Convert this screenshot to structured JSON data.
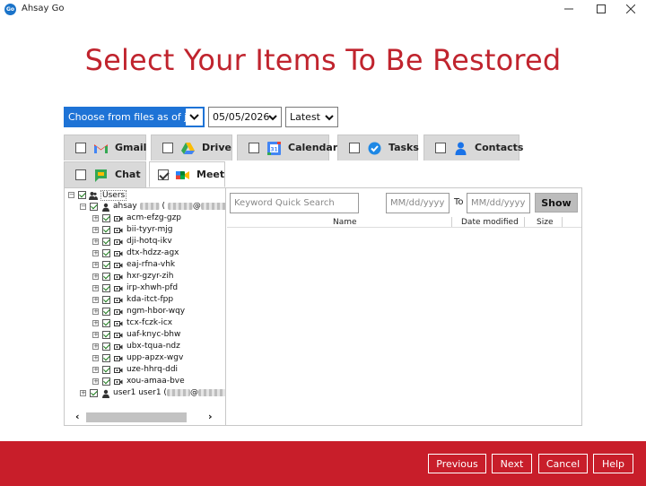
{
  "app": {
    "title": "Ahsay Go",
    "logo_text": "Go"
  },
  "window_controls": {
    "minimize": "—",
    "maximize": "☐",
    "close": "✕"
  },
  "heading": "Select Your Items To Be Restored",
  "filters": {
    "job_mode": "Choose from files as of job",
    "date": "05/05/2026",
    "version": "Latest"
  },
  "tabs": [
    {
      "label": "Gmail",
      "checked": false,
      "icon": "gmail-icon"
    },
    {
      "label": "Drive",
      "checked": false,
      "icon": "drive-icon"
    },
    {
      "label": "Calendar",
      "checked": false,
      "icon": "calendar-icon"
    },
    {
      "label": "Tasks",
      "checked": false,
      "icon": "tasks-icon"
    },
    {
      "label": "Contacts",
      "checked": false,
      "icon": "contacts-icon"
    },
    {
      "label": "Chat",
      "checked": false,
      "icon": "chat-icon"
    },
    {
      "label": "Meet",
      "checked": true,
      "icon": "meet-icon",
      "active": true
    }
  ],
  "tree": {
    "root": "Users",
    "user1_prefix": "ahsay",
    "user1_suffix": "(",
    "user1_at": "@",
    "meetings": [
      "acm-efzg-gzp",
      "bii-tyyr-mjg",
      "dji-hotq-ikv",
      "dtx-hdzz-agx",
      "eaj-rfna-vhk",
      "hxr-gzyr-zih",
      "irp-xhwh-pfd",
      "kda-itct-fpp",
      "ngm-hbor-wqy",
      "tcx-fczk-icx",
      "uaf-knyc-bhw",
      "ubx-tqua-ndz",
      "upp-apzx-wgv",
      "uze-hhrq-ddi",
      "xou-amaa-bve"
    ],
    "user2_prefix": "user1 user1 (",
    "user2_at": "@"
  },
  "search": {
    "placeholder": "Keyword Quick Search"
  },
  "date_range": {
    "from_placeholder": "MM/dd/yyyy",
    "to_label": "To",
    "to_placeholder": "MM/dd/yyyy",
    "show_label": "Show"
  },
  "list_columns": {
    "name": "Name",
    "date_modified": "Date modified",
    "size": "Size"
  },
  "footer": {
    "previous": "Previous",
    "next": "Next",
    "cancel": "Cancel",
    "help": "Help"
  },
  "colors": {
    "brand_red": "#c81e2a",
    "heading_red": "#c0242e",
    "selected_blue": "#1e73d6"
  }
}
